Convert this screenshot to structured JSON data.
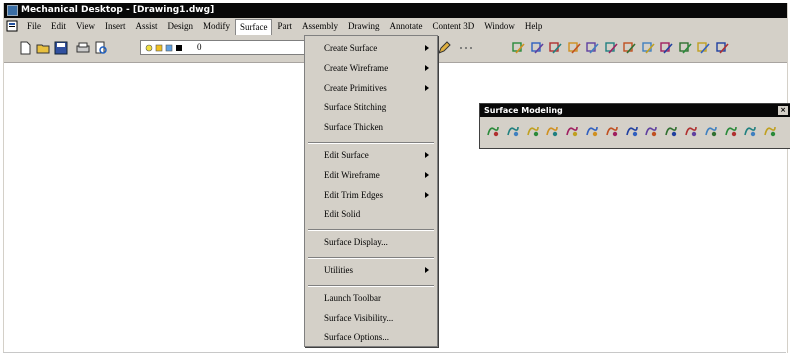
{
  "window": {
    "title": "Mechanical Desktop - [Drawing1.dwg]"
  },
  "menubar": {
    "items": [
      "File",
      "Edit",
      "View",
      "Insert",
      "Assist",
      "Design",
      "Modify",
      "Surface",
      "Part",
      "Assembly",
      "Drawing",
      "Annotate",
      "Content 3D",
      "Window",
      "Help"
    ],
    "active": "Surface"
  },
  "toolbar": {
    "layer_value": "0"
  },
  "surface_menu": {
    "items": [
      {
        "label": "Create Surface",
        "submenu": true
      },
      {
        "label": "Create Wireframe",
        "submenu": true
      },
      {
        "label": "Create Primitives",
        "submenu": true
      },
      {
        "label": "Surface Stitching",
        "submenu": false
      },
      {
        "label": "Surface Thicken",
        "submenu": false
      },
      {
        "label": "Edit Surface",
        "submenu": true
      },
      {
        "label": "Edit Wireframe",
        "submenu": true
      },
      {
        "label": "Edit Trim Edges",
        "submenu": true
      },
      {
        "label": "Edit Solid",
        "submenu": false
      },
      {
        "label": "Surface Display...",
        "submenu": false
      },
      {
        "label": "Utilities",
        "submenu": true
      },
      {
        "label": "Launch Toolbar",
        "submenu": false
      },
      {
        "label": "Surface Visibility...",
        "submenu": false
      },
      {
        "label": "Surface Options...",
        "submenu": false
      }
    ]
  },
  "floating_toolbar": {
    "title": "Surface Modeling",
    "close_glyph": "×"
  },
  "icons": {
    "main": [
      "new-icon",
      "open-icon",
      "save-icon",
      "print-icon",
      "preview-icon"
    ],
    "right": [
      "line-icon",
      "pline-icon",
      "rect-icon",
      "rotate-icon",
      "move-icon",
      "copy-icon",
      "mirror-icon",
      "fillet-icon",
      "chamfer-icon",
      "trim-icon",
      "extend-icon",
      "properties-icon"
    ],
    "floating": [
      "surface-icon",
      "revolve-icon",
      "sweep-icon",
      "loft-icon",
      "blend-icon",
      "offset-icon",
      "fillet-icon",
      "corner-icon",
      "join-icon",
      "trim-icon",
      "extend-icon",
      "flowline-icon",
      "project-icon",
      "cut-icon",
      "auto-icon"
    ]
  },
  "colors": {
    "title_bg": "#080808",
    "chrome": "#d4d0c8",
    "canvas": "#ffffff"
  }
}
